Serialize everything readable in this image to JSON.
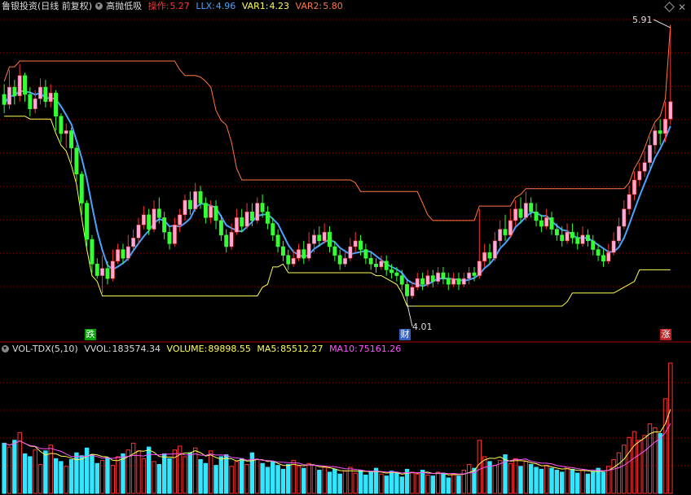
{
  "top_panel": {
    "stock": "鲁银投资(日线 前复权)",
    "indicator": "高抛低吸",
    "items": [
      {
        "label": "操作:",
        "value": "5.27",
        "color": "#ff3333"
      },
      {
        "label": "LLX:",
        "value": "4.96",
        "color": "#4aa3ff"
      },
      {
        "label": "VAR1:",
        "value": "4.23",
        "color": "#ffff55"
      },
      {
        "label": "VAR2:",
        "value": "5.80",
        "color": "#ff7744"
      }
    ],
    "high_label": "5.91",
    "low_label": "4.01",
    "marks": [
      {
        "text": "跌",
        "bg": "#00a000"
      },
      {
        "text": "财",
        "bg": "#3060c0"
      },
      {
        "text": "涨",
        "bg": "#c02020"
      }
    ]
  },
  "bottom_panel": {
    "indicator": "VOL-TDX(5,10)",
    "items": [
      {
        "label": "VVOL:",
        "value": "183574.34",
        "color": "#dddddd"
      },
      {
        "label": "VOLUME:",
        "value": "89898.55",
        "color": "#ffff55"
      },
      {
        "label": "MA5:",
        "value": "85512.27",
        "color": "#ffff55"
      },
      {
        "label": "MA10:",
        "value": "75161.26",
        "color": "#ff55ff"
      }
    ]
  },
  "colors": {
    "up": "#ff3333",
    "up_body": "#ffaad6",
    "down": "#33ff33",
    "vol_up": "#ff3333",
    "vol_down": "#33e6ff",
    "llx": "#4aa3ff",
    "var1": "#ffff55",
    "var2": "#ff7744",
    "grid": "#8b0000"
  },
  "chart_data": {
    "type": "candlestick",
    "price_ylim": [
      3.9,
      6.0
    ],
    "candles": [
      [
        5.45,
        5.38,
        5.52,
        5.32
      ],
      [
        5.38,
        5.5,
        5.62,
        5.35
      ],
      [
        5.5,
        5.44,
        5.55,
        5.38
      ],
      [
        5.44,
        5.58,
        5.66,
        5.4
      ],
      [
        5.58,
        5.45,
        5.6,
        5.4
      ],
      [
        5.45,
        5.35,
        5.5,
        5.3
      ],
      [
        5.35,
        5.42,
        5.48,
        5.32
      ],
      [
        5.42,
        5.5,
        5.56,
        5.38
      ],
      [
        5.5,
        5.4,
        5.55,
        5.36
      ],
      [
        5.4,
        5.46,
        5.52,
        5.36
      ],
      [
        5.46,
        5.3,
        5.48,
        5.2
      ],
      [
        5.3,
        5.18,
        5.32,
        5.12
      ],
      [
        5.18,
        5.2,
        5.25,
        5.08
      ],
      [
        5.2,
        5.08,
        5.22,
        4.98
      ],
      [
        5.08,
        4.9,
        5.1,
        4.85
      ],
      [
        4.9,
        4.7,
        4.92,
        4.62
      ],
      [
        4.7,
        4.45,
        4.72,
        4.4
      ],
      [
        4.45,
        4.28,
        4.48,
        4.22
      ],
      [
        4.28,
        4.2,
        4.32,
        4.18
      ],
      [
        4.2,
        4.25,
        4.34,
        4.08
      ],
      [
        4.25,
        4.18,
        4.3,
        4.14
      ],
      [
        4.18,
        4.3,
        4.38,
        4.16
      ],
      [
        4.3,
        4.38,
        4.42,
        4.28
      ],
      [
        4.38,
        4.32,
        4.42,
        4.28
      ],
      [
        4.32,
        4.4,
        4.48,
        4.3
      ],
      [
        4.4,
        4.46,
        4.52,
        4.38
      ],
      [
        4.46,
        4.55,
        4.6,
        4.42
      ],
      [
        4.55,
        4.62,
        4.68,
        4.52
      ],
      [
        4.62,
        4.52,
        4.66,
        4.48
      ],
      [
        4.52,
        4.66,
        4.72,
        4.5
      ],
      [
        4.66,
        4.6,
        4.74,
        4.56
      ],
      [
        4.6,
        4.5,
        4.64,
        4.45
      ],
      [
        4.5,
        4.42,
        4.54,
        4.38
      ],
      [
        4.42,
        4.55,
        4.6,
        4.4
      ],
      [
        4.55,
        4.62,
        4.66,
        4.5
      ],
      [
        4.62,
        4.72,
        4.76,
        4.58
      ],
      [
        4.72,
        4.66,
        4.78,
        4.62
      ],
      [
        4.66,
        4.78,
        4.84,
        4.64
      ],
      [
        4.78,
        4.7,
        4.82,
        4.66
      ],
      [
        4.7,
        4.6,
        4.74,
        4.56
      ],
      [
        4.6,
        4.68,
        4.72,
        4.56
      ],
      [
        4.68,
        4.58,
        4.72,
        4.52
      ],
      [
        4.58,
        4.48,
        4.62,
        4.44
      ],
      [
        4.48,
        4.4,
        4.52,
        4.36
      ],
      [
        4.4,
        4.5,
        4.56,
        4.38
      ],
      [
        4.5,
        4.6,
        4.66,
        4.48
      ],
      [
        4.6,
        4.54,
        4.66,
        4.5
      ],
      [
        4.54,
        4.64,
        4.7,
        4.52
      ],
      [
        4.64,
        4.58,
        4.7,
        4.54
      ],
      [
        4.58,
        4.7,
        4.74,
        4.56
      ],
      [
        4.7,
        4.64,
        4.76,
        4.6
      ],
      [
        4.64,
        4.56,
        4.68,
        4.52
      ],
      [
        4.56,
        4.48,
        4.6,
        4.44
      ],
      [
        4.48,
        4.4,
        4.52,
        4.36
      ],
      [
        4.4,
        4.34,
        4.44,
        4.3
      ],
      [
        4.34,
        4.28,
        4.38,
        4.24
      ],
      [
        4.28,
        4.32,
        4.38,
        4.26
      ],
      [
        4.32,
        4.38,
        4.42,
        4.3
      ],
      [
        4.38,
        4.32,
        4.44,
        4.28
      ],
      [
        4.32,
        4.42,
        4.5,
        4.3
      ],
      [
        4.42,
        4.48,
        4.52,
        4.36
      ],
      [
        4.48,
        4.44,
        4.54,
        4.4
      ],
      [
        4.44,
        4.5,
        4.56,
        4.42
      ],
      [
        4.5,
        4.4,
        4.54,
        4.36
      ],
      [
        4.4,
        4.34,
        4.44,
        4.3
      ],
      [
        4.34,
        4.28,
        4.38,
        4.24
      ],
      [
        4.28,
        4.32,
        4.38,
        4.26
      ],
      [
        4.32,
        4.4,
        4.46,
        4.3
      ],
      [
        4.4,
        4.44,
        4.5,
        4.36
      ],
      [
        4.44,
        4.38,
        4.48,
        4.34
      ],
      [
        4.38,
        4.32,
        4.42,
        4.28
      ],
      [
        4.32,
        4.28,
        4.36,
        4.24
      ],
      [
        4.28,
        4.26,
        4.32,
        4.22
      ],
      [
        4.26,
        4.3,
        4.34,
        4.24
      ],
      [
        4.3,
        4.24,
        4.34,
        4.2
      ],
      [
        4.24,
        4.22,
        4.28,
        4.18
      ],
      [
        4.22,
        4.2,
        4.26,
        4.16
      ],
      [
        4.2,
        4.14,
        4.24,
        4.1
      ],
      [
        4.14,
        4.06,
        4.18,
        4.01
      ],
      [
        4.06,
        4.12,
        4.16,
        4.04
      ],
      [
        4.12,
        4.18,
        4.22,
        4.1
      ],
      [
        4.18,
        4.14,
        4.22,
        4.1
      ],
      [
        4.14,
        4.2,
        4.24,
        4.12
      ],
      [
        4.2,
        4.16,
        4.24,
        4.12
      ],
      [
        4.16,
        4.22,
        4.26,
        4.14
      ],
      [
        4.22,
        4.18,
        4.26,
        4.14
      ],
      [
        4.18,
        4.14,
        4.22,
        4.1
      ],
      [
        4.14,
        4.18,
        4.22,
        4.12
      ],
      [
        4.18,
        4.14,
        4.22,
        4.1
      ],
      [
        4.14,
        4.18,
        4.22,
        4.12
      ],
      [
        4.18,
        4.22,
        4.26,
        4.14
      ],
      [
        4.22,
        4.2,
        4.26,
        4.16
      ],
      [
        4.2,
        4.3,
        4.66,
        4.18
      ],
      [
        4.3,
        4.36,
        4.42,
        4.26
      ],
      [
        4.36,
        4.32,
        4.42,
        4.28
      ],
      [
        4.32,
        4.44,
        4.5,
        4.3
      ],
      [
        4.44,
        4.52,
        4.58,
        4.4
      ],
      [
        4.52,
        4.48,
        4.62,
        4.44
      ],
      [
        4.48,
        4.58,
        4.66,
        4.46
      ],
      [
        4.58,
        4.66,
        4.72,
        4.54
      ],
      [
        4.66,
        4.6,
        4.74,
        4.56
      ],
      [
        4.6,
        4.7,
        4.78,
        4.58
      ],
      [
        4.7,
        4.64,
        4.74,
        4.6
      ],
      [
        4.64,
        4.58,
        4.7,
        4.54
      ],
      [
        4.58,
        4.54,
        4.62,
        4.5
      ],
      [
        4.54,
        4.6,
        4.66,
        4.52
      ],
      [
        4.6,
        4.52,
        4.64,
        4.48
      ],
      [
        4.52,
        4.48,
        4.56,
        4.44
      ],
      [
        4.48,
        4.44,
        4.54,
        4.4
      ],
      [
        4.44,
        4.5,
        4.56,
        4.42
      ],
      [
        4.5,
        4.46,
        4.56,
        4.42
      ],
      [
        4.46,
        4.42,
        4.5,
        4.38
      ],
      [
        4.42,
        4.48,
        4.54,
        4.4
      ],
      [
        4.48,
        4.44,
        4.52,
        4.4
      ],
      [
        4.44,
        4.38,
        4.48,
        4.34
      ],
      [
        4.38,
        4.34,
        4.42,
        4.3
      ],
      [
        4.34,
        4.3,
        4.38,
        4.26
      ],
      [
        4.3,
        4.36,
        4.42,
        4.28
      ],
      [
        4.36,
        4.44,
        4.5,
        4.34
      ],
      [
        4.44,
        4.54,
        4.6,
        4.42
      ],
      [
        4.54,
        4.66,
        4.72,
        4.52
      ],
      [
        4.66,
        4.76,
        4.82,
        4.62
      ],
      [
        4.76,
        4.86,
        4.92,
        4.72
      ],
      [
        4.86,
        4.92,
        4.98,
        4.82
      ],
      [
        4.92,
        4.98,
        5.06,
        4.88
      ],
      [
        4.98,
        5.1,
        5.16,
        4.94
      ],
      [
        5.1,
        5.2,
        5.24,
        5.04
      ],
      [
        5.2,
        5.18,
        5.28,
        5.1
      ],
      [
        5.18,
        5.28,
        5.4,
        5.12
      ],
      [
        5.28,
        5.4,
        5.91,
        5.24
      ]
    ],
    "volumes": [
      52,
      48,
      55,
      63,
      41,
      38,
      45,
      30,
      44,
      50,
      36,
      33,
      28,
      35,
      42,
      39,
      47,
      40,
      31,
      34,
      37,
      29,
      38,
      41,
      45,
      52,
      44,
      36,
      48,
      33,
      30,
      41,
      36,
      45,
      49,
      38,
      42,
      47,
      35,
      31,
      44,
      29,
      38,
      40,
      28,
      33,
      36,
      30,
      42,
      35,
      31,
      27,
      33,
      29,
      25,
      30,
      34,
      28,
      26,
      31,
      29,
      24,
      27,
      22,
      25,
      20,
      23,
      27,
      21,
      24,
      19,
      22,
      26,
      20,
      18,
      23,
      21,
      17,
      25,
      22,
      20,
      24,
      19,
      18,
      22,
      21,
      16,
      20,
      18,
      24,
      30,
      26,
      55,
      38,
      33,
      29,
      34,
      40,
      31,
      36,
      28,
      33,
      30,
      27,
      25,
      29,
      26,
      24,
      22,
      27,
      25,
      21,
      24,
      20,
      23,
      26,
      22,
      28,
      35,
      42,
      50,
      58,
      64,
      55,
      60,
      72,
      68,
      62,
      98,
      135
    ]
  }
}
